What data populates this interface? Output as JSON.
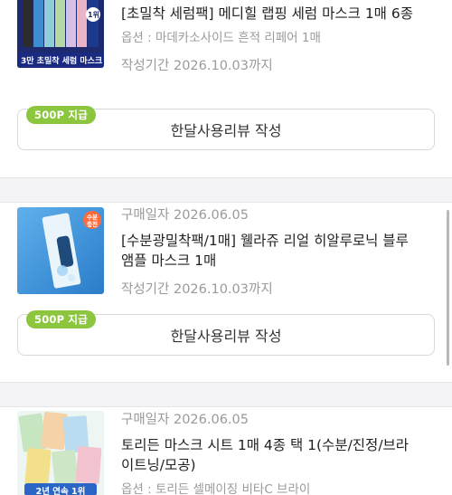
{
  "orders": [
    {
      "purchase_date_label": "",
      "title": "[초밀착 세럼팩] 메디힐 랩핑 세럼 마스크 1매 6종",
      "option": "옵션 : 마데카소사이드 흔적 리페어 1매",
      "period": "작성기간 2026.10.03까지",
      "thumb_caption": "3만 초밀착 세럼 마스크",
      "thumb_badge": "1위",
      "point_badge": "500P 지급",
      "review_button": "한달사용리뷰 작성"
    },
    {
      "purchase_date_label": "구매일자 2026.06.05",
      "title": "[수분광밀착팩/1매] 웰라쥬 리얼 히알루로닉 블루 앰플 마스크 1매",
      "option": "",
      "period": "작성기간 2026.10.03까지",
      "thumb_caption": "",
      "thumb_badge": "수분 충전",
      "point_badge": "500P 지급",
      "review_button": "한달사용리뷰 작성"
    },
    {
      "purchase_date_label": "구매일자 2026.06.05",
      "title": "토리든 마스크 시트 1매 4종 택 1(수분/진정/브라이트닝/모공)",
      "option": "옵션 : 토리든 셀메이징 비타C 브라이",
      "period": "",
      "thumb_caption": "2년 연속 1위",
      "thumb_badge": "",
      "point_badge": "",
      "review_button": ""
    }
  ],
  "colors": {
    "point_badge_bg": "#8cc63f",
    "muted_text": "#9a9a9a",
    "divider_bg": "#f4f4f6"
  }
}
